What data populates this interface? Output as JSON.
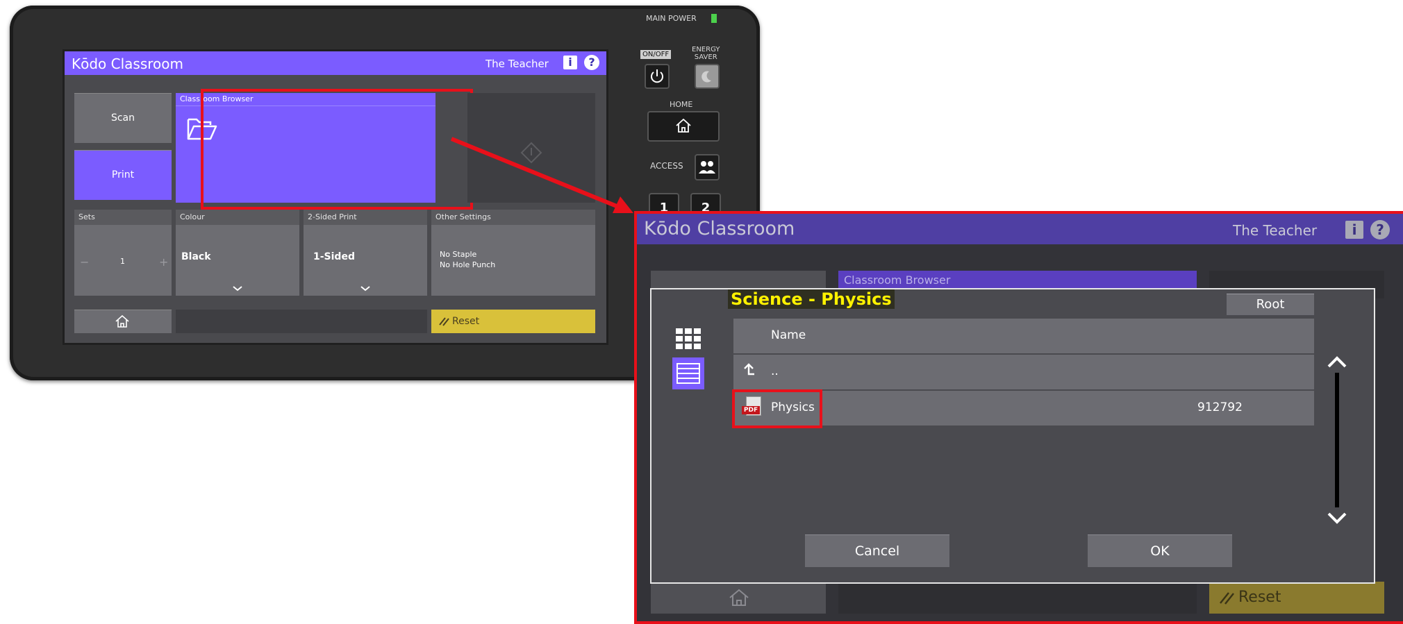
{
  "device": {
    "main_power": "MAIN POWER",
    "on_off": "ON/OFF",
    "energy_saver": "ENERGY\nSAVER",
    "home": "HOME",
    "access": "ACCESS",
    "keys": [
      "1",
      "2"
    ]
  },
  "screen": {
    "app_title": "Kōdo Classroom",
    "user": "The Teacher",
    "info_label": "i",
    "help_label": "?",
    "scan_label": "Scan",
    "print_label": "Print",
    "browser_label": "Classroom Browser",
    "sets": {
      "header": "Sets",
      "minus": "−",
      "value": "1",
      "plus": "+"
    },
    "colour": {
      "header": "Colour",
      "value": "Black"
    },
    "sided": {
      "header": "2-Sided Print",
      "value": "1-Sided"
    },
    "other": {
      "header": "Other Settings",
      "line1": "No Staple",
      "line2": "No Hole Punch"
    },
    "reset_label": "Reset"
  },
  "zoom": {
    "app_title": "Kōdo Classroom",
    "user": "The Teacher",
    "info_label": "i",
    "help_label": "?",
    "browser_label": "Classroom Browser",
    "reset_label": "Reset",
    "dialog": {
      "folder_title": "Science - Physics",
      "root_label": "Root",
      "column_name": "Name",
      "up_label": "..",
      "files": [
        {
          "name": "Physics",
          "size": "912792",
          "icon": "pdf-icon",
          "icon_text": "PDF"
        }
      ],
      "cancel_label": "Cancel",
      "ok_label": "OK"
    }
  },
  "colors": {
    "accent": "#7b5cff",
    "highlight_border": "#e8101a",
    "folder_title_bg": "#fff200",
    "reset": "#d9c13a"
  }
}
